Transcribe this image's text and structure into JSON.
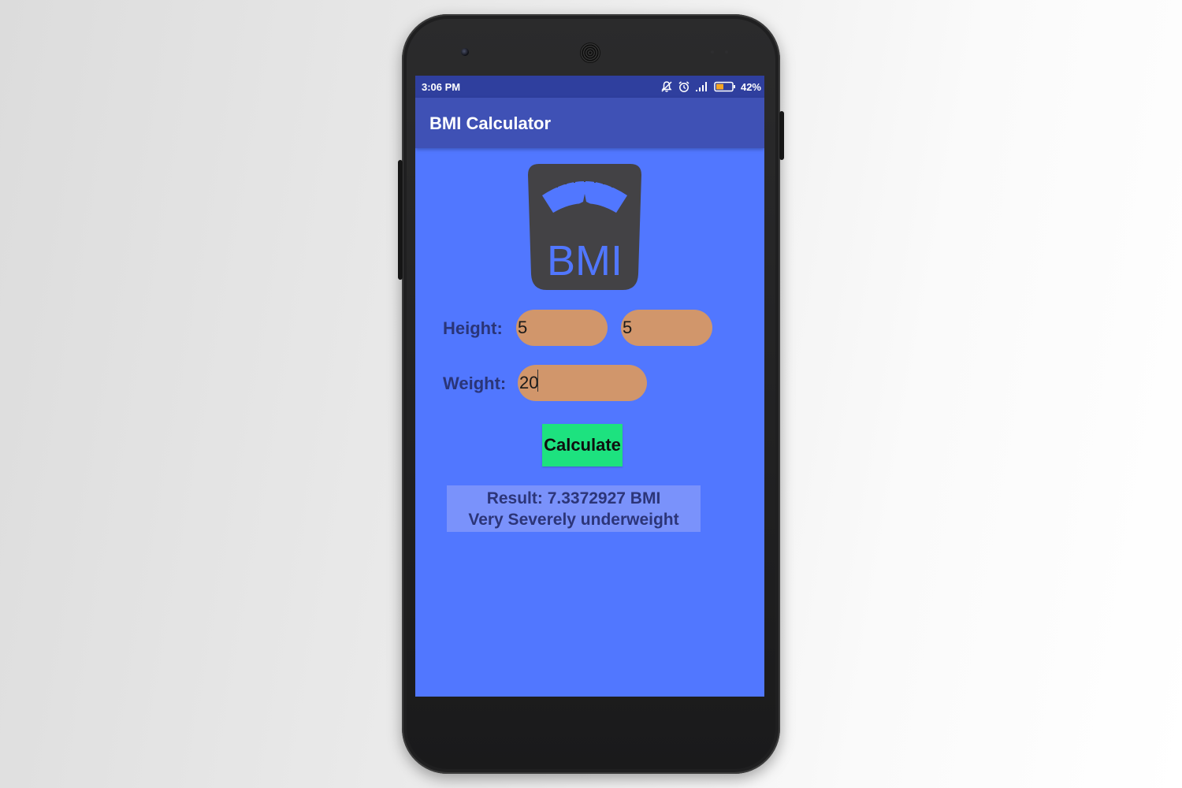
{
  "status_bar": {
    "time": "3:06 PM",
    "battery_percent": "42%",
    "icons": [
      "mute-icon",
      "alarm-icon",
      "signal-icon",
      "battery-icon"
    ]
  },
  "app_bar": {
    "title": "BMI Calculator"
  },
  "logo": {
    "text": "BMI",
    "icon": "scale-icon"
  },
  "form": {
    "height_label": "Height:",
    "height_feet_value": "5",
    "height_inches_value": "5",
    "weight_label": "Weight:",
    "weight_value": "20",
    "calculate_label": "Calculate"
  },
  "result": {
    "line1": "Result: 7.3372927 BMI",
    "line2": "Very Severely underweight"
  },
  "colors": {
    "screen_bg": "#5177ff",
    "status_bar": "#2f3f9e",
    "app_bar": "#3f51b5",
    "input_bg": "#d1966b",
    "button_bg": "#1de27f",
    "result_bg": "#7a92fb",
    "label_text": "#2a3578"
  }
}
